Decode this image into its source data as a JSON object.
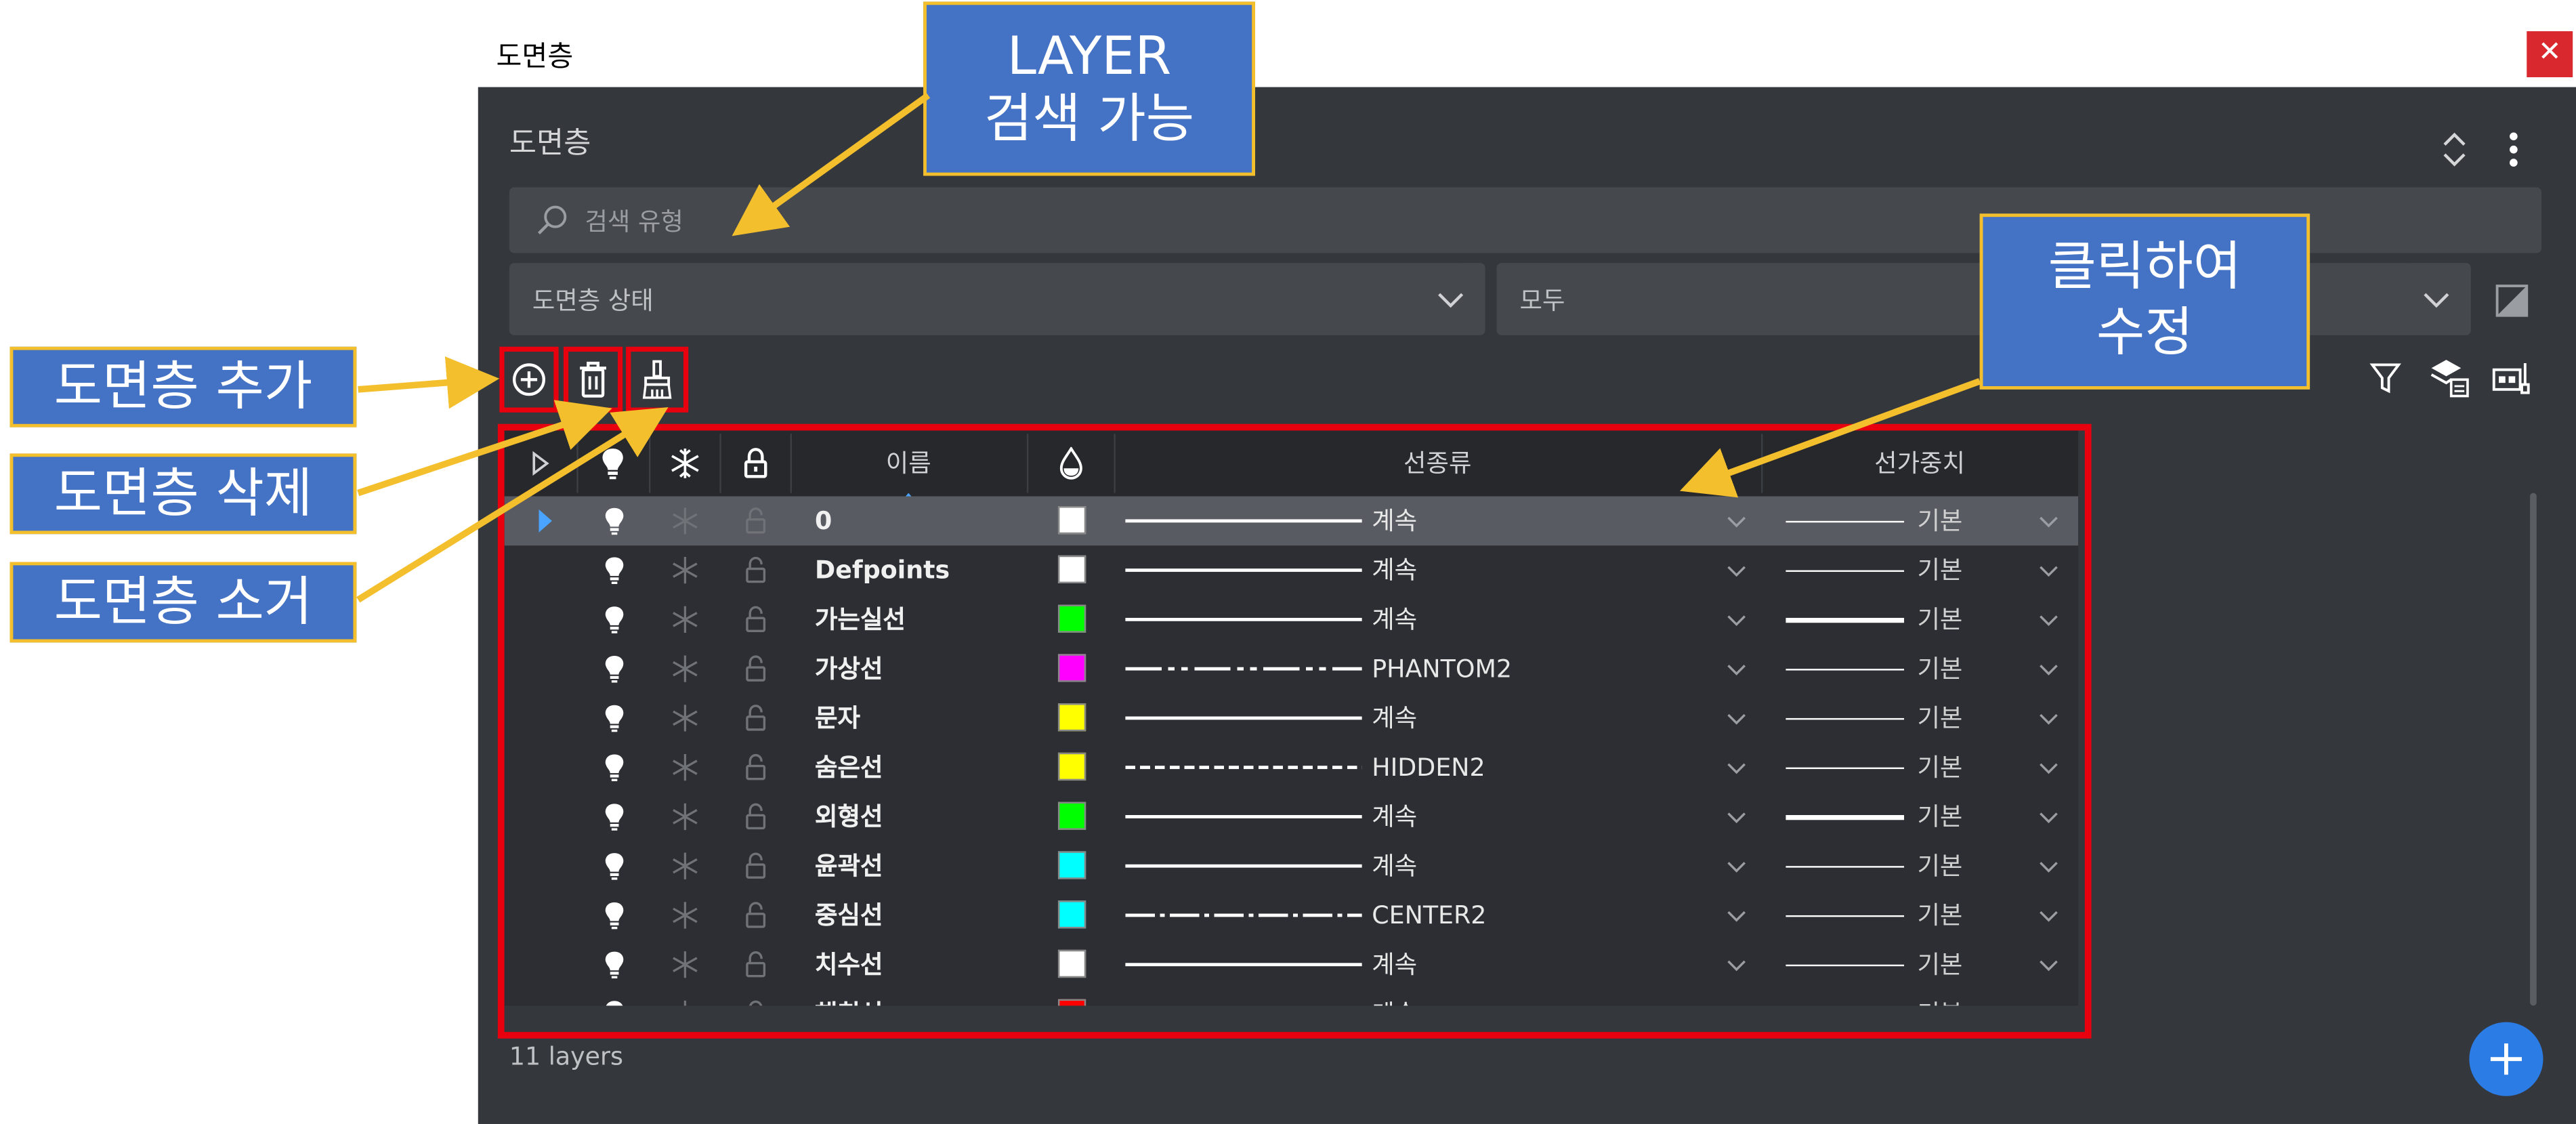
{
  "window": {
    "title": "도면층",
    "close_glyph": "✕"
  },
  "panel": {
    "title": "도면층",
    "search_placeholder": "검색 유형",
    "filter_state": "도면층 상태",
    "filter_all": "모두",
    "layer_count": "11 layers"
  },
  "table": {
    "headers": {
      "name": "이름",
      "linetype": "선종류",
      "lineweight": "선가중치"
    },
    "rows": [
      {
        "name": "0",
        "color": "#ffffff",
        "linetype": "계속",
        "lt_style": "solid",
        "lineweight": "기본",
        "lw_thick": false,
        "selected": true
      },
      {
        "name": "Defpoints",
        "color": "#ffffff",
        "linetype": "계속",
        "lt_style": "solid",
        "lineweight": "기본",
        "lw_thick": false,
        "selected": false
      },
      {
        "name": "가는실선",
        "color": "#00ff00",
        "linetype": "계속",
        "lt_style": "solid",
        "lineweight": "기본",
        "lw_thick": true,
        "selected": false
      },
      {
        "name": "가상선",
        "color": "#ff00ff",
        "linetype": "PHANTOM2",
        "lt_style": "phantom",
        "lineweight": "기본",
        "lw_thick": false,
        "selected": false
      },
      {
        "name": "문자",
        "color": "#ffff00",
        "linetype": "계속",
        "lt_style": "solid",
        "lineweight": "기본",
        "lw_thick": false,
        "selected": false
      },
      {
        "name": "숨은선",
        "color": "#ffff00",
        "linetype": "HIDDEN2",
        "lt_style": "hidden",
        "lineweight": "기본",
        "lw_thick": false,
        "selected": false
      },
      {
        "name": "외형선",
        "color": "#00ff00",
        "linetype": "계속",
        "lt_style": "solid",
        "lineweight": "기본",
        "lw_thick": true,
        "selected": false
      },
      {
        "name": "윤곽선",
        "color": "#00ffff",
        "linetype": "계속",
        "lt_style": "solid",
        "lineweight": "기본",
        "lw_thick": false,
        "selected": false
      },
      {
        "name": "중심선",
        "color": "#00ffff",
        "linetype": "CENTER2",
        "lt_style": "center",
        "lineweight": "기본",
        "lw_thick": false,
        "selected": false
      },
      {
        "name": "치수선",
        "color": "#ffffff",
        "linetype": "계속",
        "lt_style": "solid",
        "lineweight": "기본",
        "lw_thick": false,
        "selected": false
      },
      {
        "name": "해칭선",
        "color": "#ff0000",
        "linetype": "계속",
        "lt_style": "solid",
        "lineweight": "기본",
        "lw_thick": false,
        "selected": false
      }
    ]
  },
  "callouts": {
    "search_line1": "LAYER",
    "search_line2": "검색 가능",
    "edit_line1": "클릭하여",
    "edit_line2": "수정",
    "add": "도면층 추가",
    "delete": "도면층 삭제",
    "purge": "도면층 소거"
  },
  "colors": {
    "panel_bg": "#34373c",
    "header_bg": "#26282c",
    "selected_row": "#585b61",
    "highlight_box": "#e8000e",
    "callout_fill": "#4472c4",
    "callout_border": "#f4bf2c",
    "accent_blue": "#2c7ce6"
  },
  "icons": [
    "search-icon",
    "chevron-down-icon",
    "expand-collapse-icon",
    "more-vertical-icon",
    "add-layer-icon",
    "delete-layer-icon",
    "purge-brush-icon",
    "filter-icon",
    "layer-states-icon",
    "layer-properties-icon",
    "bulb-icon",
    "freeze-icon",
    "lock-icon",
    "color-drop-icon",
    "plus-icon"
  ]
}
